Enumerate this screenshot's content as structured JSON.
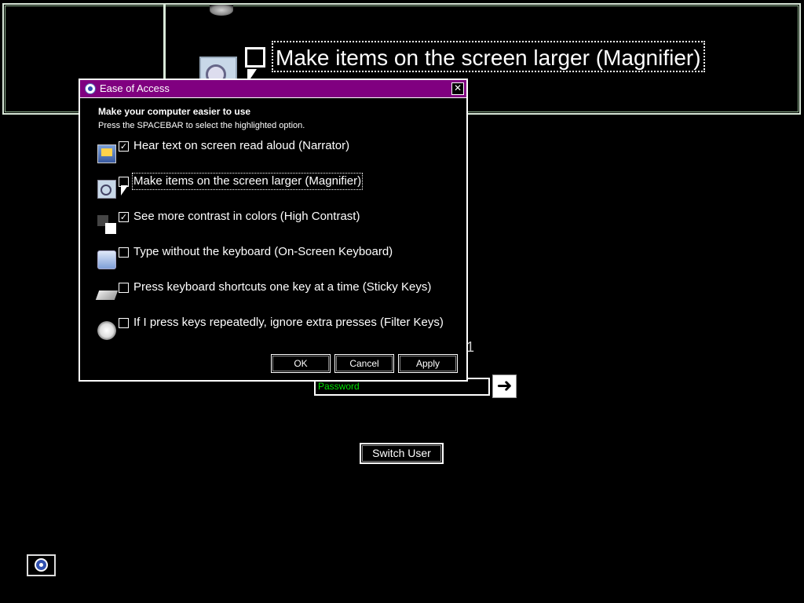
{
  "magnifier": {
    "label": "Make items on the screen larger (Magnifier)"
  },
  "dialog": {
    "title": "Ease of Access",
    "close_glyph": "✕",
    "heading": "Make your computer easier to use",
    "subheading": "Press the SPACEBAR to select the highlighted option.",
    "options": [
      {
        "label": "Hear text on screen read aloud (Narrator)",
        "checked": true,
        "icon": "narrator-icon"
      },
      {
        "label": "Make items on the screen larger (Magnifier)",
        "checked": false,
        "icon": "magnifier-icon",
        "focused": true
      },
      {
        "label": "See more contrast in colors (High Contrast)",
        "checked": true,
        "icon": "high-contrast-icon"
      },
      {
        "label": "Type without the keyboard (On-Screen Keyboard)",
        "checked": false,
        "icon": "on-screen-keyboard-icon"
      },
      {
        "label": "Press keyboard shortcuts one key at a time (Sticky Keys)",
        "checked": false,
        "icon": "sticky-keys-icon"
      },
      {
        "label": "If I press keys repeatedly, ignore extra presses (Filter Keys)",
        "checked": false,
        "icon": "filter-keys-icon"
      }
    ],
    "ok_label": "OK",
    "cancel_label": "Cancel",
    "apply_label": "Apply"
  },
  "login": {
    "partial_text": "1",
    "password_placeholder": "Password",
    "go_glyph": "➜",
    "switch_user_label": "Switch User"
  },
  "colors": {
    "titlebar": "#800080",
    "password_text": "#00e000"
  }
}
